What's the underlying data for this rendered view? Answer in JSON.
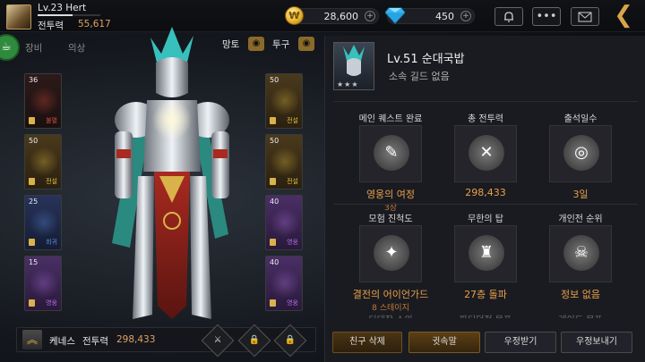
{
  "header": {
    "level_name": "Lv.23 Hert",
    "cp_label": "전투력",
    "cp_value": "55,617",
    "gold": "28,600",
    "gems": "450",
    "icons": [
      "bell-icon",
      "more-icon",
      "mail-icon",
      "back-icon"
    ]
  },
  "left": {
    "tabs": [
      "장비",
      "의상"
    ],
    "toggles": {
      "cape": "망토",
      "helmet": "투구"
    },
    "left_slots": [
      {
        "level": "36",
        "tier": "불멸",
        "tier_color": "#d44a3a",
        "bg": "s-red"
      },
      {
        "level": "50",
        "tier": "전설",
        "tier_color": "#e6c040",
        "bg": "s-gold"
      },
      {
        "level": "25",
        "tier": "희귀",
        "tier_color": "#5f8fe0",
        "bg": "s-blue"
      },
      {
        "level": "15",
        "tier": "영웅",
        "tier_color": "#b070e0",
        "bg": "s-purple"
      }
    ],
    "right_slots": [
      {
        "level": "50",
        "tier": "전설",
        "tier_color": "#e6c040",
        "bg": "s-gold"
      },
      {
        "level": "50",
        "tier": "전설",
        "tier_color": "#e6c040",
        "bg": "s-gold"
      },
      {
        "level": "40",
        "tier": "영웅",
        "tier_color": "#b070e0",
        "bg": "s-purple"
      },
      {
        "level": "40",
        "tier": "영웅",
        "tier_color": "#b070e0",
        "bg": "s-purple"
      }
    ],
    "bottom": {
      "name": "케네스",
      "cp_label": "전투력",
      "cp_value": "298,433"
    }
  },
  "profile": {
    "name": "Lv.51 순대국밥",
    "guild": "소속 길드 없음",
    "stats": [
      {
        "title": "메인 퀘스트 완료",
        "value": "영웅의 여정",
        "sub": "3장",
        "icon": "quest-icon"
      },
      {
        "title": "총 전투력",
        "value": "298,433",
        "sub": "",
        "icon": "swords-icon"
      },
      {
        "title": "출석일수",
        "value": "3일",
        "sub": "",
        "icon": "calendar-icon"
      },
      {
        "title": "모험 진척도",
        "value": "결전의 어이언가드",
        "sub": "8 스테이지",
        "icon": "compass-icon"
      },
      {
        "title": "무한의 탑",
        "value": "27층 돌파",
        "sub": "",
        "icon": "tower-icon"
      },
      {
        "title": "개인전 순위",
        "value": "정보 없음",
        "sub": "",
        "icon": "skull-icon"
      }
    ],
    "cutoff_labels": [
      "티대장 소위",
      "파티던전 목표",
      "레이드 목표"
    ]
  },
  "actions": [
    "친구 삭제",
    "귓속말",
    "우정받기",
    "우정보내기"
  ]
}
